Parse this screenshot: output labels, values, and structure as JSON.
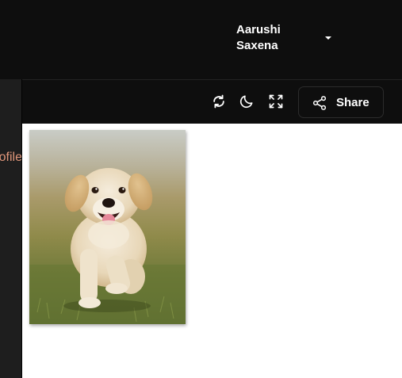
{
  "user": {
    "name": "Aarushi Saxena"
  },
  "sidebar": {
    "partial_label": "ofile"
  },
  "toolbar": {
    "refresh_icon": "refresh-icon",
    "theme_icon": "moon-icon",
    "fullscreen_icon": "fullscreen-icon",
    "share_icon": "share-icon",
    "share_label": "Share"
  },
  "content": {
    "image_subject": "golden retriever puppy running on grass"
  },
  "colors": {
    "topbar_bg": "#0e0e0e",
    "sidebar_bg": "#1e1e1e",
    "accent_text": "#e0967a",
    "content_bg": "#ffffff"
  }
}
